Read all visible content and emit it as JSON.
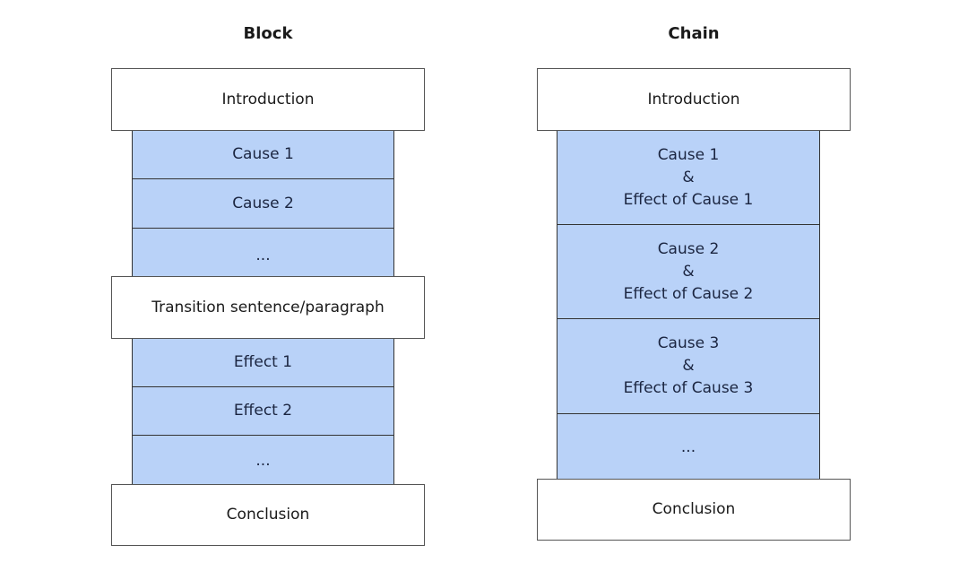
{
  "block": {
    "title": "Block",
    "introduction": "Introduction",
    "causes": [
      "Cause 1",
      "Cause 2",
      "..."
    ],
    "transition": "Transition sentence/paragraph",
    "effects": [
      "Effect 1",
      "Effect 2",
      "..."
    ],
    "conclusion": "Conclusion"
  },
  "chain": {
    "title": "Chain",
    "introduction": "Introduction",
    "pairs": [
      {
        "cause": "Cause 1",
        "amp": "&",
        "effect": "Effect of Cause 1"
      },
      {
        "cause": "Cause 2",
        "amp": "&",
        "effect": "Effect of Cause 2"
      },
      {
        "cause": "Cause 3",
        "amp": "&",
        "effect": "Effect of Cause 3"
      }
    ],
    "ellipsis": "...",
    "conclusion": "Conclusion"
  },
  "colors": {
    "fill": "#b9d2f8",
    "border": "#333333"
  }
}
